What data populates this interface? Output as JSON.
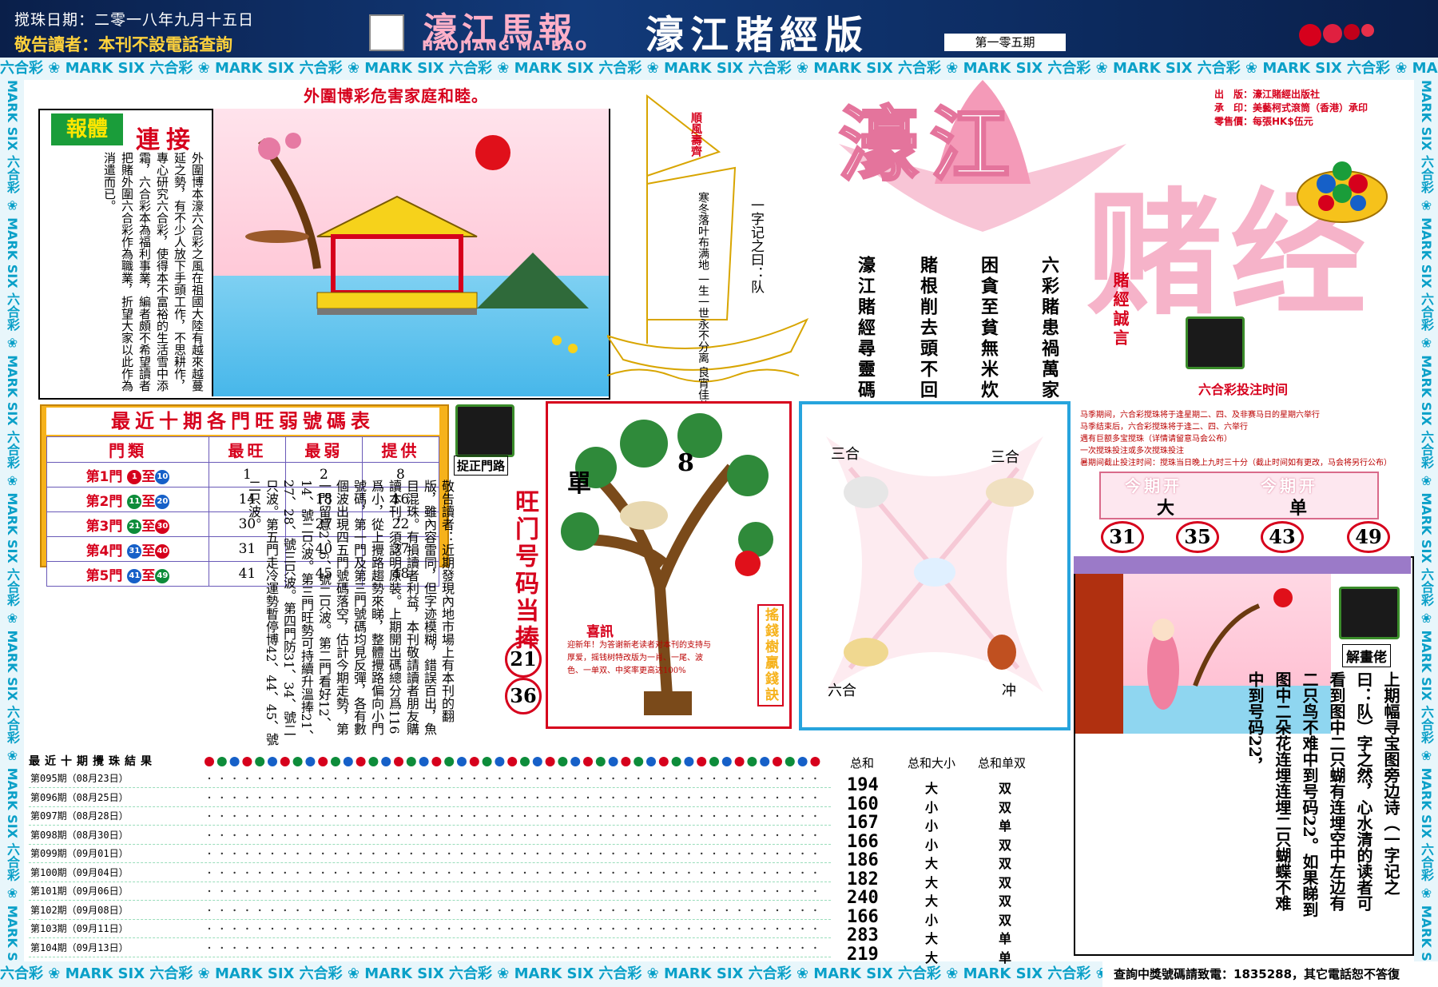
{
  "header": {
    "date": "搅珠日期：二零一八年九月十五日",
    "notice": "敬告讀者：本刊不設電話查詢",
    "logo_cn": "濠江馬報",
    "logo_en": "HAOJIANG MA BAO",
    "edition": "濠江賭經版",
    "issue": "第一零五期"
  },
  "border": {
    "repeat": "六合彩 ❀ MARK SIX 六合彩 ❀ MARK SIX 六合彩 ❀ MARK SIX 六合彩 ❀ MARK SIX 六合彩 ❀ MARK SIX 六合彩 ❀ MARK SIX 六合彩 ❀ MARK SIX 六合彩 ❀ MARK SIX 六合彩 ❀ MARK SIX 六合彩 ❀ MARK SIX 六合彩 ❀ MARK SIX",
    "vertical": "MARK SIX 六合彩 ❀ MARK SIX 六合彩 ❀ MARK SIX 六合彩 ❀ MARK SIX 六合彩 ❀ MARK SIX 六合彩 ❀ MARK SIX 六合彩 ❀ MARK SIX 六合彩 ❀ MARK SIX 六合彩",
    "hotline": "查詢中獎號碼請致電：1835288，其它電話恕不答復"
  },
  "panel1": {
    "headline": "外圍博彩危害家庭和睦。",
    "badge_a": "報體",
    "badge_b": "連接",
    "body": "外圍博本濠六合彩之風在祖國大陸有越來越蔓延之勢，有不少人放下手頭工作，不思耕作，專心研究六合彩，使得本不富裕的生活雪中添霜，六合彩本為福利事業，編者頗不希望讀者把賭外圍六合彩作為職業，折望大家以此作為消遣而已。"
  },
  "sailboat": {
    "flag": "順風壽齊",
    "poem": "寒冬落叶布满地 一生一世永不分离 良宵佳节开心过 春天播种秋天在收",
    "caption": "一字记之曰：队"
  },
  "verses": [
    "六彩賭患禍萬家",
    "困貪至貧無米炊",
    "賭根削去頭不回",
    "濠江賭經尋靈碼"
  ],
  "title": {
    "big1": "濠江",
    "big2": "赌经",
    "motto": "賭經誠言"
  },
  "pubinfo": {
    "publisher": "出　版：濠江賭經出版社",
    "printer": "承　印：美藝柯式滾筒（香港）承印",
    "price": "零售價：每張HK$伍元"
  },
  "bettime": {
    "title": "六合彩投注时间",
    "notes": [
      "马季期间，六合彩搅珠将于逢星期二、四、及非赛马日的星期六举行",
      "马季结束后，六合彩搅珠将于逢二、四、六举行",
      "遇有巨额多宝搅珠（详情请留意马会公布）",
      "一次搅珠投注或多次搅珠投注",
      "暑期间截止投注时间：搅珠当日晚上九时三十分（截止时间如有更改，马会将另行公布）"
    ]
  },
  "table": {
    "title": "最近十期各門旺弱號碼表",
    "headers": [
      "門類",
      "最旺",
      "最弱",
      "提供"
    ],
    "rows": [
      {
        "gate": "第1門",
        "from": "1",
        "to": "10",
        "hot": "1",
        "cold": "2",
        "give": "8"
      },
      {
        "gate": "第2門",
        "from": "11",
        "to": "20",
        "hot": "14",
        "cold": "18",
        "give": "16"
      },
      {
        "gate": "第3門",
        "from": "21",
        "to": "30",
        "hot": "30",
        "cold": "27",
        "give": "22"
      },
      {
        "gate": "第4門",
        "from": "31",
        "to": "40",
        "hot": "31",
        "cold": "40",
        "give": "37"
      },
      {
        "gate": "第5門",
        "from": "41",
        "to": "49",
        "hot": "41",
        "cold": "45",
        "give": "48"
      }
    ],
    "to_word": "至"
  },
  "gate": {
    "label": "捉正門路",
    "readers": "敬告讀者：近期發現內地市場上有本刊的翻版，雖內容雷同，但字迹模糊，錯誤百出，魚目混珠。有損讀者利益，本刊敬請讀者朋友購讀本刊，須認明原裝。上期開出碼總分爲116爲小，從上攪路趨勢來睇，整體攪路偏向小門號碼，第一門及第三門號碼均見反彈，各有數個波出現四五門號碼落空，估計今期走勢，第一門留意2、6、號二只波。第二門看好12、14、號二只波。第三門旺勢可持續升溫捧21、27、28、號三只波。第四門防31、34、號二只波。第五門走冷運勢暫停博42、44、45、號二只波。",
    "hot_label": "旺门号码当捧",
    "hot_nums": [
      "21",
      "36"
    ]
  },
  "tree": {
    "dan": "單",
    "num": "8",
    "side": "搖錢樹贏錢訣",
    "xixun": "喜訊",
    "xixun_text": "迎新年！为答谢新老读者对本刊的支持与厚爱，摇钱树特改版为一肖、一尾、波色、一单双、中奖率更高达100%"
  },
  "zodiac": {
    "tl": "三合",
    "tr": "三合",
    "bl": "六合",
    "br": "冲"
  },
  "periods": {
    "label1": "今期开",
    "value1": "大",
    "label2": "今期开",
    "value2": "单",
    "nums": [
      "31",
      "35",
      "43",
      "49"
    ]
  },
  "decode": {
    "label": "解畫佬",
    "text": "上期幅寻宝图旁边诗（一字记之曰：队）字之然，心水清的读者可看到图中二只蝴有连埋空中左边有二只鸟不难中到号码22。如果睇到图中二朵花连埋连埋二只蝴蝶不难中到号码22，"
  },
  "results": {
    "title": "最近十期攪珠結果",
    "sum_head": [
      "总和",
      "总和大小",
      "总和单双"
    ],
    "rows": [
      {
        "label": "第095期（08月23日）",
        "sum": "194",
        "size": "大",
        "parity": "双"
      },
      {
        "label": "第096期（08月25日）",
        "sum": "160",
        "size": "小",
        "parity": "双"
      },
      {
        "label": "第097期（08月28日）",
        "sum": "167",
        "size": "小",
        "parity": "单"
      },
      {
        "label": "第098期（08月30日）",
        "sum": "166",
        "size": "小",
        "parity": "双"
      },
      {
        "label": "第099期（09月01日）",
        "sum": "186",
        "size": "大",
        "parity": "双"
      },
      {
        "label": "第100期（09月04日）",
        "sum": "182",
        "size": "大",
        "parity": "双"
      },
      {
        "label": "第101期（09月06日）",
        "sum": "240",
        "size": "大",
        "parity": "双"
      },
      {
        "label": "第102期（09月08日）",
        "sum": "166",
        "size": "小",
        "parity": "双"
      },
      {
        "label": "第103期（09月11日）",
        "sum": "283",
        "size": "大",
        "parity": "单"
      },
      {
        "label": "第104期（09月13日）",
        "sum": "219",
        "size": "大",
        "parity": "单"
      }
    ]
  }
}
